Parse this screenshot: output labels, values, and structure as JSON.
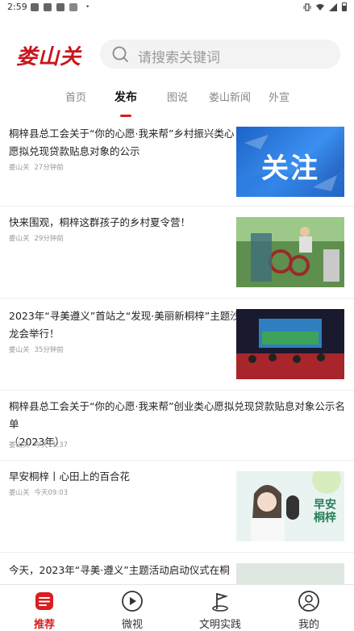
{
  "status": {
    "time": "2:59"
  },
  "header": {
    "logo_text": "娄山关",
    "search_placeholder": "请搜索关键词"
  },
  "tabs": [
    {
      "label": "首页"
    },
    {
      "label": "发布"
    },
    {
      "label": "图说"
    },
    {
      "label": "娄山新闻"
    },
    {
      "label": "外宣"
    }
  ],
  "news": [
    {
      "title_line1": "桐梓县总工会关于“你的心愿·我来帮”乡村振兴类心",
      "title_line2": "愿拟兑现贷款贴息对象的公示",
      "source": "娄山关",
      "time": "27分钟前",
      "thumb_text": "关注"
    },
    {
      "title_line1": "快来围观，桐梓这群孩子的乡村夏令营！",
      "title_line2": "",
      "source": "娄山关",
      "time": "29分钟前"
    },
    {
      "title_line1": "2023年“寻美遵义”首站之“发现·美丽新桐梓”主题沙",
      "title_line2": "龙会举行！",
      "source": "娄山关",
      "time": "35分钟前"
    },
    {
      "title_line1": "桐梓县总工会关于“你的心愿·我来帮”创业类心愿拟兑现贷款贴息对象公示名单",
      "title_line2": "（2023年）",
      "source": "娄山关",
      "time": "今天11:37"
    },
    {
      "title_line1": "早安桐梓丨心田上的百合花",
      "title_line2": "",
      "source": "娄山关",
      "time": "今天09:03",
      "thumb_text": "早安桐梓"
    },
    {
      "title_line1": "今天，2023年“寻美·遵义”主题活动启动仪式在桐",
      "title_line2": "",
      "source": "",
      "time": ""
    }
  ],
  "bottom_nav": [
    {
      "label": "推荐",
      "icon": "recommend-icon"
    },
    {
      "label": "微视",
      "icon": "play-icon"
    },
    {
      "label": "文明实践",
      "icon": "flag-icon"
    },
    {
      "label": "我的",
      "icon": "user-icon"
    }
  ],
  "colors": {
    "accent": "#d81e1e",
    "logo": "#c8161d"
  }
}
